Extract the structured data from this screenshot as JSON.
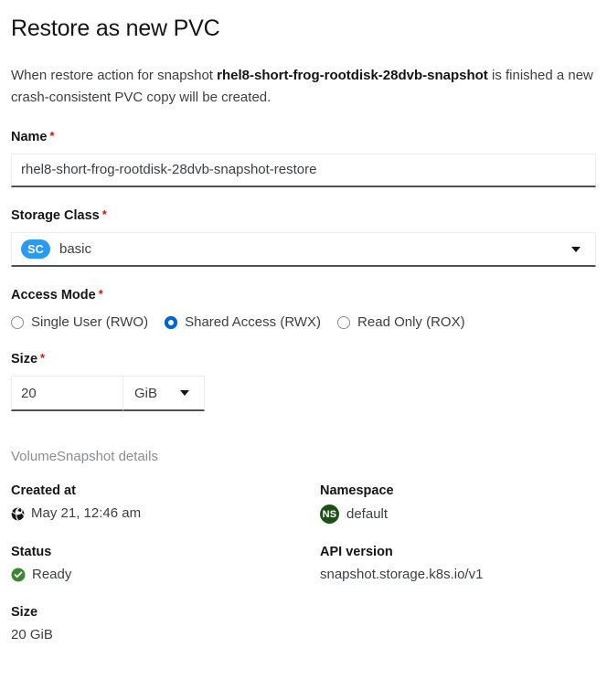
{
  "dialog": {
    "title": "Restore as new PVC",
    "description_prefix": "When restore action for snapshot ",
    "description_snapshot_name": "rhel8-short-frog-rootdisk-28dvb-snapshot",
    "description_suffix": " is finished a new crash-consistent PVC copy will be created."
  },
  "form": {
    "name": {
      "label": "Name",
      "required_marker": "*",
      "value": "rhel8-short-frog-rootdisk-28dvb-snapshot-restore"
    },
    "storage_class": {
      "label": "Storage Class",
      "required_marker": "*",
      "badge": "SC",
      "value": "basic",
      "caret_icon": "chevron-down-icon"
    },
    "access_mode": {
      "label": "Access Mode",
      "required_marker": "*",
      "options": [
        {
          "label": "Single User (RWO)",
          "selected": false
        },
        {
          "label": "Shared Access (RWX)",
          "selected": true
        },
        {
          "label": "Read Only (ROX)",
          "selected": false
        }
      ]
    },
    "size": {
      "label": "Size",
      "required_marker": "*",
      "value": "20",
      "unit": "GiB",
      "caret_icon": "chevron-down-icon"
    }
  },
  "details": {
    "section_title": "VolumeSnapshot details",
    "created_at": {
      "term": "Created at",
      "icon": "globe-icon",
      "value": "May 21, 12:46 am"
    },
    "namespace": {
      "term": "Namespace",
      "badge": "NS",
      "value": "default"
    },
    "status": {
      "term": "Status",
      "icon": "check-circle-icon",
      "value": "Ready"
    },
    "api_version": {
      "term": "API version",
      "value": "snapshot.storage.k8s.io/v1"
    },
    "size": {
      "term": "Size",
      "value": "20 GiB"
    }
  },
  "colors": {
    "required_red": "#c9190b",
    "sc_badge_blue": "#2b9af3",
    "ns_badge_green": "#1e4f18",
    "status_ready_green": "#3e8635",
    "radio_selected_blue": "#0066cc"
  }
}
